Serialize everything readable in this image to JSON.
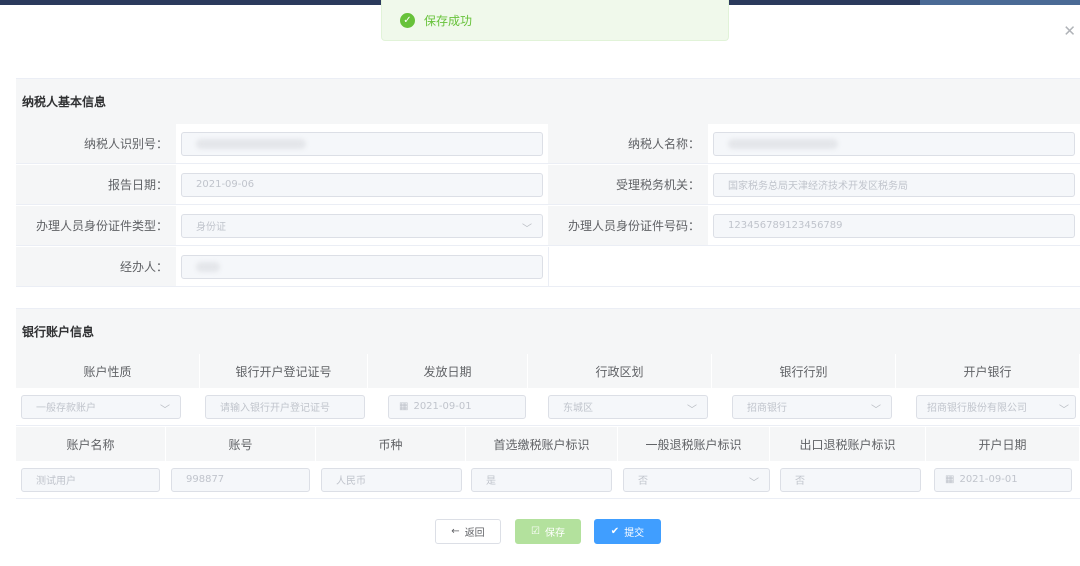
{
  "toast": {
    "message": "保存成功"
  },
  "section_taxpayer": {
    "title": "纳税人基本信息"
  },
  "taxpayer_fields": [
    {
      "label": "纳税人识别号：",
      "value": "",
      "placeholder": ""
    },
    {
      "label": "纳税人名称：",
      "value": "",
      "placeholder": ""
    },
    {
      "label": "报告日期：",
      "value": "2021-09-06"
    },
    {
      "label": "受理税务机关：",
      "value": "国家税务总局天津经济技术开发区税务局"
    },
    {
      "label": "办理人员身份证件类型：",
      "value": "身份证"
    },
    {
      "label": "办理人员身份证件号码：",
      "value": "123456789123456789"
    },
    {
      "label": "经办人：",
      "value": ""
    }
  ],
  "section_bank": {
    "title": "银行账户信息"
  },
  "bank_table1": {
    "headers": [
      "账户性质",
      "银行开户登记证号",
      "发放日期",
      "行政区划",
      "银行行别",
      "开户银行"
    ],
    "values": [
      "一般存款账户",
      "请输入银行开户登记证号",
      "2021-09-01",
      "东城区",
      "招商银行",
      "招商银行股份有限公司"
    ]
  },
  "bank_table2": {
    "headers": [
      "账户名称",
      "账号",
      "币种",
      "首选缴税账户标识",
      "一般退税账户标识",
      "出口退税账户标识",
      "开户日期"
    ],
    "values": [
      "测试用户",
      "998877",
      "人民币",
      "是",
      "否",
      "否",
      "2021-09-01"
    ]
  },
  "buttons": {
    "back": "返回",
    "save": "保存",
    "submit": "提交"
  }
}
